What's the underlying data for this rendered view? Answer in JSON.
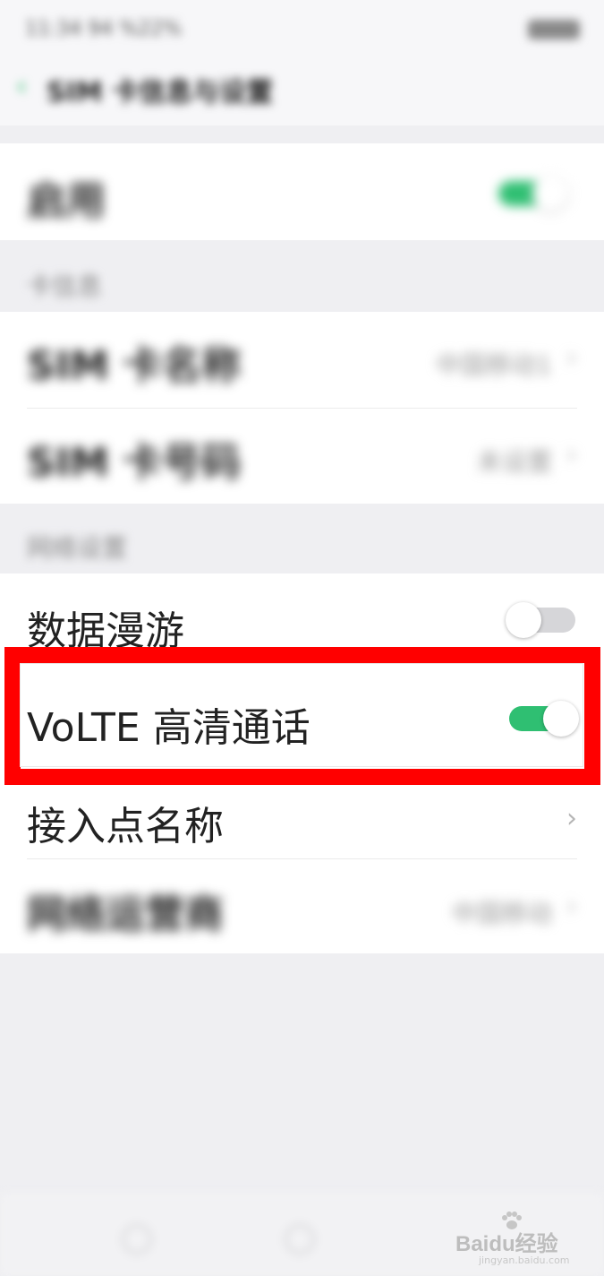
{
  "status_bar": {
    "time": "11:34 94 %22%"
  },
  "header": {
    "back_glyph": "‹",
    "title": "SIM 卡信息与设置"
  },
  "enable_row": {
    "label": "启用",
    "toggle_state": "on"
  },
  "card_section": {
    "label": "卡信息",
    "rows": [
      {
        "label": "SIM 卡名称",
        "value": "中国移动1",
        "chevron": "›"
      },
      {
        "label": "SIM 卡号码",
        "value": "未设置",
        "chevron": "›"
      }
    ]
  },
  "network_section": {
    "label": "网络设置",
    "data_roaming": {
      "label": "数据漫游",
      "toggle_state": "off"
    },
    "volte": {
      "label": "VoLTE 高清通话",
      "toggle_state": "on"
    },
    "apn": {
      "label": "接入点名称",
      "chevron": "›"
    },
    "operator": {
      "label": "网络运营商",
      "value": "中国移动",
      "chevron": "›"
    }
  },
  "watermark": {
    "brand": "Baidu经验",
    "url": "jingyan.baidu.com"
  },
  "colors": {
    "accent_green": "#2fbf72",
    "highlight_red": "#ff0000",
    "background": "#efeff2"
  },
  "icons": {
    "back": "back-arrow-icon",
    "chevron": "chevron-right-icon",
    "watermark": "baidu-paw-icon"
  }
}
